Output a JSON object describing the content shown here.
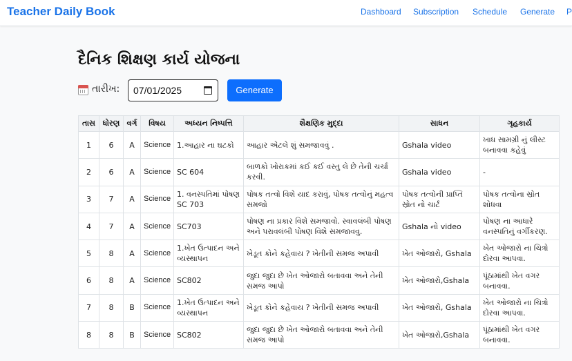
{
  "app": {
    "brand": "Teacher Daily Book"
  },
  "nav": [
    {
      "label": "Dashboard"
    },
    {
      "label": "Subscription"
    },
    {
      "label": "Schedule"
    },
    {
      "label": "Generate"
    },
    {
      "label": "P"
    }
  ],
  "page": {
    "title": "દૈનિક શિક્ષણ કાર્ય યોજના"
  },
  "form": {
    "date_icon": "calendar-icon",
    "date_label": "તારીખ:",
    "date_value": "07/01/2025",
    "generate_label": "Generate"
  },
  "table": {
    "headers": [
      "તાસ",
      "ધોરણ",
      "વર્ગ",
      "વિષય",
      "અધ્યન નિષ્પત્તિ",
      "શૈક્ષણિક મુદ્દા",
      "સાધન",
      "ગૃહકાર્ય"
    ],
    "rows": [
      [
        "1",
        "6",
        "A",
        "Science",
        "1.આહાર ના ઘટકો",
        "આહાર એટલે શું સમજાવવું .",
        "Gshala video",
        "ખાધ સામગ્રી નું લીસ્ટ બનાવવા કહેવું"
      ],
      [
        "2",
        "6",
        "A",
        "Science",
        "SC 604",
        "બાળકો ખોરાકમાં કઈ કઈ વસ્તુ લે છે તેની ચર્ચા કરવી.",
        "Gshala video",
        "-"
      ],
      [
        "3",
        "7",
        "A",
        "Science",
        "1. વનસ્પતિમાં પોષણ SC 703",
        "પોષક તત્વો વિશે યાદ કરાવું, પોષક તત્વોનું મહત્વ સમજો",
        "પોષક તત્વોની પ્રાપ્તિ સ્રોત નો ચાર્ટ",
        "પોષક તત્વોના સ્રોત શોધવા"
      ],
      [
        "4",
        "7",
        "A",
        "Science",
        "SC703",
        "પોષણ ના પ્રકાર વિશે સમજાવો. સ્વાવલંબી પોષણ અને પરાવલંબી પોષણ વિશે સમજાવવુ.",
        "Gshala નો video",
        "પોષણ ના આધારે વનસ્પતિનું વર્ગીકરણ."
      ],
      [
        "5",
        "8",
        "A",
        "Science",
        "1.ખેત ઉત્પાદન અને વ્યસ્થાપન",
        "ખેડૂત કોને કહેવાય ? ખેતીની સમજ અપાવી",
        "ખેત ઓજારો, Gshala",
        "ખેત ઓજારો ના ચિત્રો દોરવા આપવા."
      ],
      [
        "6",
        "8",
        "A",
        "Science",
        "SC802",
        "જુદા જુદા છે ખેત ઓજારો બતાવવા અને તેની સમજ આપો",
        "ખેત ઓજારો,Gshala",
        "પૂંઠામાંથી ખેત વગર બનાવવા."
      ],
      [
        "7",
        "8",
        "B",
        "Science",
        "1.ખેત ઉત્પાદન અને વ્યસ્થાપન",
        "ખેડૂત કોને કહેવાય ? ખેતીની સમજ અપાવી",
        "ખેત ઓજારો, Gshala",
        "ખેત ઓજારો ના ચિત્રો દોરવા આપવા."
      ],
      [
        "8",
        "8",
        "B",
        "Science",
        "SC802",
        "જુદા જુદા છે ખેત ઓજારો બતાવવા અને તેની સમજ આપો",
        "ખેત ઓજારો,Gshala",
        "પૂંઠામાંથી ખેત વગર બનાવવા."
      ]
    ]
  },
  "colors": {
    "brand": "#1a73e8",
    "button": "#0d6efd"
  }
}
